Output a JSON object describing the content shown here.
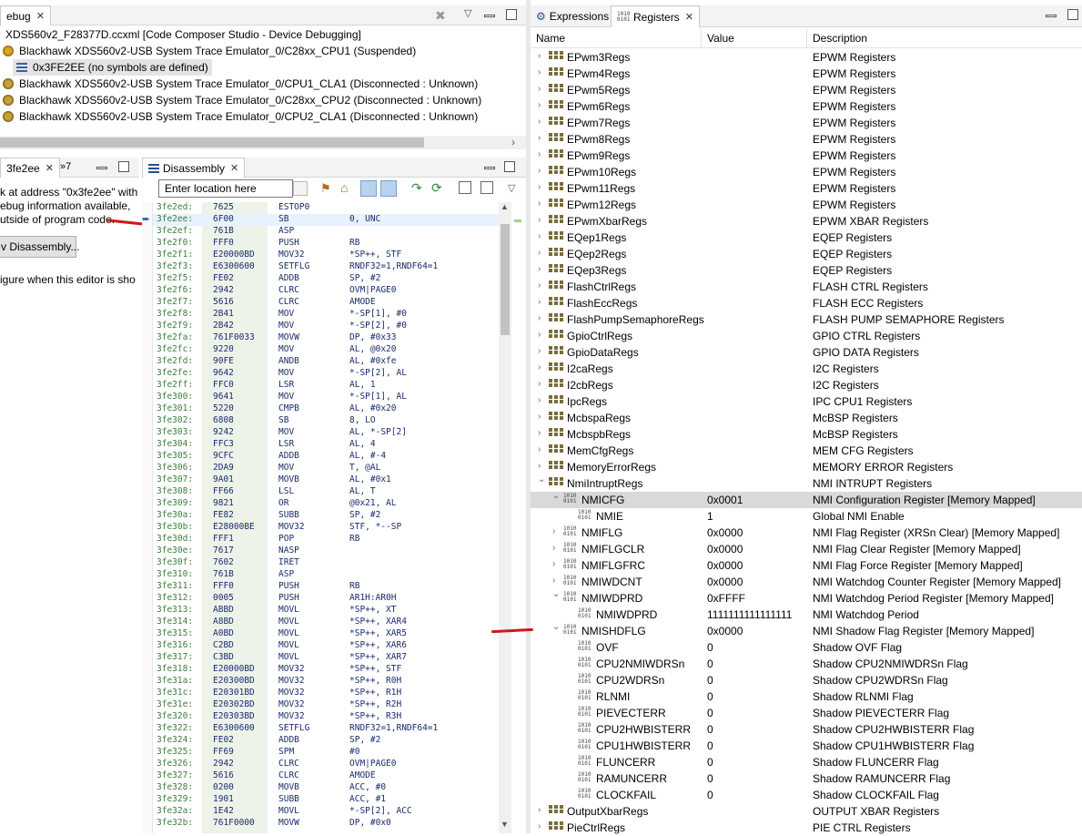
{
  "debug": {
    "tab_label": "ebug",
    "root": "XDS560v2_F28377D.ccxml [Code Composer Studio - Device Debugging]",
    "rows": [
      {
        "label": "Blackhawk XDS560v2-USB System Trace Emulator_0/C28xx_CPU1 (Suspended)"
      },
      {
        "label": "0x3FE2EE  (no symbols are defined)"
      },
      {
        "label": "Blackhawk XDS560v2-USB System Trace Emulator_0/CPU1_CLA1 (Disconnected : Unknown)"
      },
      {
        "label": "Blackhawk XDS560v2-USB System Trace Emulator_0/C28xx_CPU2 (Disconnected : Unknown)"
      },
      {
        "label": "Blackhawk XDS560v2-USB System Trace Emulator_0/CPU2_CLA1 (Disconnected : Unknown)"
      }
    ]
  },
  "editor": {
    "tab_label": "3fe2ee",
    "tab_more": "»7",
    "lines": [
      "k at address \"0x3fe2ee\" with",
      "ebug information available,",
      "utside of program code."
    ],
    "button": "v Disassembly...",
    "footer": "igure when this editor is sho"
  },
  "disassembly": {
    "tab_label": "Disassembly",
    "location_placeholder": "Enter location here",
    "rows": [
      {
        "addr": "3fe2ed:",
        "op": "7625",
        "mn": "ESTOP0",
        "arg": ""
      },
      {
        "addr": "3fe2ee:",
        "op": "6F00",
        "mn": "SB",
        "arg": "0, UNC"
      },
      {
        "addr": "3fe2ef:",
        "op": "761B",
        "mn": "ASP",
        "arg": ""
      },
      {
        "addr": "3fe2f0:",
        "op": "FFF0",
        "mn": "PUSH",
        "arg": "RB"
      },
      {
        "addr": "3fe2f1:",
        "op": "E20000BD",
        "mn": "MOV32",
        "arg": "*SP++, STF"
      },
      {
        "addr": "3fe2f3:",
        "op": "E6300600",
        "mn": "SETFLG",
        "arg": "RNDF32=1,RNDF64=1"
      },
      {
        "addr": "3fe2f5:",
        "op": "FE02",
        "mn": "ADDB",
        "arg": "SP, #2"
      },
      {
        "addr": "3fe2f6:",
        "op": "2942",
        "mn": "CLRC",
        "arg": "OVM|PAGE0"
      },
      {
        "addr": "3fe2f7:",
        "op": "5616",
        "mn": "CLRC",
        "arg": "AMODE"
      },
      {
        "addr": "3fe2f8:",
        "op": "2B41",
        "mn": "MOV",
        "arg": "*-SP[1], #0"
      },
      {
        "addr": "3fe2f9:",
        "op": "2B42",
        "mn": "MOV",
        "arg": "*-SP[2], #0"
      },
      {
        "addr": "3fe2fa:",
        "op": "761F0033",
        "mn": "MOVW",
        "arg": "DP, #0x33"
      },
      {
        "addr": "3fe2fc:",
        "op": "9220",
        "mn": "MOV",
        "arg": "AL, @0x20"
      },
      {
        "addr": "3fe2fd:",
        "op": "90FE",
        "mn": "ANDB",
        "arg": "AL, #0xfe"
      },
      {
        "addr": "3fe2fe:",
        "op": "9642",
        "mn": "MOV",
        "arg": "*-SP[2], AL"
      },
      {
        "addr": "3fe2ff:",
        "op": "FFC0",
        "mn": "LSR",
        "arg": "AL, 1"
      },
      {
        "addr": "3fe300:",
        "op": "9641",
        "mn": "MOV",
        "arg": "*-SP[1], AL"
      },
      {
        "addr": "3fe301:",
        "op": "5220",
        "mn": "CMPB",
        "arg": "AL, #0x20"
      },
      {
        "addr": "3fe302:",
        "op": "6808",
        "mn": "SB",
        "arg": "8, LO"
      },
      {
        "addr": "3fe303:",
        "op": "9242",
        "mn": "MOV",
        "arg": "AL, *-SP[2]"
      },
      {
        "addr": "3fe304:",
        "op": "FFC3",
        "mn": "LSR",
        "arg": "AL, 4"
      },
      {
        "addr": "3fe305:",
        "op": "9CFC",
        "mn": "ADDB",
        "arg": "AL, #-4"
      },
      {
        "addr": "3fe306:",
        "op": "2DA9",
        "mn": "MOV",
        "arg": "T, @AL"
      },
      {
        "addr": "3fe307:",
        "op": "9A01",
        "mn": "MOVB",
        "arg": "AL, #0x1"
      },
      {
        "addr": "3fe308:",
        "op": "FF66",
        "mn": "LSL",
        "arg": "AL, T"
      },
      {
        "addr": "3fe309:",
        "op": "9821",
        "mn": "OR",
        "arg": "@0x21, AL"
      },
      {
        "addr": "3fe30a:",
        "op": "FE82",
        "mn": "SUBB",
        "arg": "SP, #2"
      },
      {
        "addr": "3fe30b:",
        "op": "E28000BE",
        "mn": "MOV32",
        "arg": "STF, *--SP"
      },
      {
        "addr": "3fe30d:",
        "op": "FFF1",
        "mn": "POP",
        "arg": "RB"
      },
      {
        "addr": "3fe30e:",
        "op": "7617",
        "mn": "NASP",
        "arg": ""
      },
      {
        "addr": "3fe30f:",
        "op": "7602",
        "mn": "IRET",
        "arg": ""
      },
      {
        "addr": "3fe310:",
        "op": "761B",
        "mn": "ASP",
        "arg": ""
      },
      {
        "addr": "3fe311:",
        "op": "FFF0",
        "mn": "PUSH",
        "arg": "RB"
      },
      {
        "addr": "3fe312:",
        "op": "0005",
        "mn": "PUSH",
        "arg": "AR1H:AR0H"
      },
      {
        "addr": "3fe313:",
        "op": "ABBD",
        "mn": "MOVL",
        "arg": "*SP++, XT"
      },
      {
        "addr": "3fe314:",
        "op": "A8BD",
        "mn": "MOVL",
        "arg": "*SP++, XAR4"
      },
      {
        "addr": "3fe315:",
        "op": "A0BD",
        "mn": "MOVL",
        "arg": "*SP++, XAR5"
      },
      {
        "addr": "3fe316:",
        "op": "C2BD",
        "mn": "MOVL",
        "arg": "*SP++, XAR6"
      },
      {
        "addr": "3fe317:",
        "op": "C3BD",
        "mn": "MOVL",
        "arg": "*SP++, XAR7"
      },
      {
        "addr": "3fe318:",
        "op": "E20000BD",
        "mn": "MOV32",
        "arg": "*SP++, STF"
      },
      {
        "addr": "3fe31a:",
        "op": "E20300BD",
        "mn": "MOV32",
        "arg": "*SP++, R0H"
      },
      {
        "addr": "3fe31c:",
        "op": "E20301BD",
        "mn": "MOV32",
        "arg": "*SP++, R1H"
      },
      {
        "addr": "3fe31e:",
        "op": "E20302BD",
        "mn": "MOV32",
        "arg": "*SP++, R2H"
      },
      {
        "addr": "3fe320:",
        "op": "E20303BD",
        "mn": "MOV32",
        "arg": "*SP++, R3H"
      },
      {
        "addr": "3fe322:",
        "op": "E6300600",
        "mn": "SETFLG",
        "arg": "RNDF32=1,RNDF64=1"
      },
      {
        "addr": "3fe324:",
        "op": "FE02",
        "mn": "ADDB",
        "arg": "SP, #2"
      },
      {
        "addr": "3fe325:",
        "op": "FF69",
        "mn": "SPM",
        "arg": "#0"
      },
      {
        "addr": "3fe326:",
        "op": "2942",
        "mn": "CLRC",
        "arg": "OVM|PAGE0"
      },
      {
        "addr": "3fe327:",
        "op": "5616",
        "mn": "CLRC",
        "arg": "AMODE"
      },
      {
        "addr": "3fe328:",
        "op": "0200",
        "mn": "MOVB",
        "arg": "ACC, #0"
      },
      {
        "addr": "3fe329:",
        "op": "1901",
        "mn": "SUBB",
        "arg": "ACC, #1"
      },
      {
        "addr": "3fe32a:",
        "op": "1E42",
        "mn": "MOVL",
        "arg": "*-SP[2], ACC"
      },
      {
        "addr": "3fe32b:",
        "op": "761F0000",
        "mn": "MOVW",
        "arg": "DP, #0x0"
      }
    ]
  },
  "registers": {
    "tab_expressions": "Expressions",
    "tab_registers": "Registers",
    "col_name": "Name",
    "col_value": "Value",
    "col_desc": "Description",
    "rows": [
      {
        "level": 0,
        "exp": "closed",
        "icon": "grid",
        "name": "EPwm3Regs",
        "value": "",
        "desc": "EPWM Registers"
      },
      {
        "level": 0,
        "exp": "closed",
        "icon": "grid",
        "name": "EPwm4Regs",
        "value": "",
        "desc": "EPWM Registers"
      },
      {
        "level": 0,
        "exp": "closed",
        "icon": "grid",
        "name": "EPwm5Regs",
        "value": "",
        "desc": "EPWM Registers"
      },
      {
        "level": 0,
        "exp": "closed",
        "icon": "grid",
        "name": "EPwm6Regs",
        "value": "",
        "desc": "EPWM Registers"
      },
      {
        "level": 0,
        "exp": "closed",
        "icon": "grid",
        "name": "EPwm7Regs",
        "value": "",
        "desc": "EPWM Registers"
      },
      {
        "level": 0,
        "exp": "closed",
        "icon": "grid",
        "name": "EPwm8Regs",
        "value": "",
        "desc": "EPWM Registers"
      },
      {
        "level": 0,
        "exp": "closed",
        "icon": "grid",
        "name": "EPwm9Regs",
        "value": "",
        "desc": "EPWM Registers"
      },
      {
        "level": 0,
        "exp": "closed",
        "icon": "grid",
        "name": "EPwm10Regs",
        "value": "",
        "desc": "EPWM Registers"
      },
      {
        "level": 0,
        "exp": "closed",
        "icon": "grid",
        "name": "EPwm11Regs",
        "value": "",
        "desc": "EPWM Registers"
      },
      {
        "level": 0,
        "exp": "closed",
        "icon": "grid",
        "name": "EPwm12Regs",
        "value": "",
        "desc": "EPWM Registers"
      },
      {
        "level": 0,
        "exp": "closed",
        "icon": "grid",
        "name": "EPwmXbarRegs",
        "value": "",
        "desc": "EPWM XBAR Registers"
      },
      {
        "level": 0,
        "exp": "closed",
        "icon": "grid",
        "name": "EQep1Regs",
        "value": "",
        "desc": "EQEP Registers"
      },
      {
        "level": 0,
        "exp": "closed",
        "icon": "grid",
        "name": "EQep2Regs",
        "value": "",
        "desc": "EQEP Registers"
      },
      {
        "level": 0,
        "exp": "closed",
        "icon": "grid",
        "name": "EQep3Regs",
        "value": "",
        "desc": "EQEP Registers"
      },
      {
        "level": 0,
        "exp": "closed",
        "icon": "grid",
        "name": "FlashCtrlRegs",
        "value": "",
        "desc": "FLASH CTRL Registers"
      },
      {
        "level": 0,
        "exp": "closed",
        "icon": "grid",
        "name": "FlashEccRegs",
        "value": "",
        "desc": "FLASH ECC Registers"
      },
      {
        "level": 0,
        "exp": "closed",
        "icon": "grid",
        "name": "FlashPumpSemaphoreRegs",
        "value": "",
        "desc": "FLASH PUMP SEMAPHORE Registers"
      },
      {
        "level": 0,
        "exp": "closed",
        "icon": "grid",
        "name": "GpioCtrlRegs",
        "value": "",
        "desc": "GPIO CTRL Registers"
      },
      {
        "level": 0,
        "exp": "closed",
        "icon": "grid",
        "name": "GpioDataRegs",
        "value": "",
        "desc": "GPIO DATA Registers"
      },
      {
        "level": 0,
        "exp": "closed",
        "icon": "grid",
        "name": "I2caRegs",
        "value": "",
        "desc": "I2C Registers"
      },
      {
        "level": 0,
        "exp": "closed",
        "icon": "grid",
        "name": "I2cbRegs",
        "value": "",
        "desc": "I2C Registers"
      },
      {
        "level": 0,
        "exp": "closed",
        "icon": "grid",
        "name": "IpcRegs",
        "value": "",
        "desc": "IPC CPU1 Registers"
      },
      {
        "level": 0,
        "exp": "closed",
        "icon": "grid",
        "name": "McbspaRegs",
        "value": "",
        "desc": "McBSP Registers"
      },
      {
        "level": 0,
        "exp": "closed",
        "icon": "grid",
        "name": "McbspbRegs",
        "value": "",
        "desc": "McBSP Registers"
      },
      {
        "level": 0,
        "exp": "closed",
        "icon": "grid",
        "name": "MemCfgRegs",
        "value": "",
        "desc": "MEM CFG Registers"
      },
      {
        "level": 0,
        "exp": "closed",
        "icon": "grid",
        "name": "MemoryErrorRegs",
        "value": "",
        "desc": "MEMORY ERROR Registers"
      },
      {
        "level": 0,
        "exp": "open",
        "icon": "grid",
        "name": "NmiIntruptRegs",
        "value": "",
        "desc": "NMI INTRUPT Registers"
      },
      {
        "level": 1,
        "exp": "open",
        "icon": "bits",
        "name": "NMICFG",
        "value": "0x0001",
        "desc": "NMI Configuration Register [Memory Mapped]",
        "sel": true
      },
      {
        "level": 2,
        "exp": "none",
        "icon": "bits",
        "name": "NMIE",
        "value": "1",
        "desc": "Global NMI Enable"
      },
      {
        "level": 1,
        "exp": "closed",
        "icon": "bits",
        "name": "NMIFLG",
        "value": "0x0000",
        "desc": "NMI Flag Register (XRSn Clear) [Memory Mapped]"
      },
      {
        "level": 1,
        "exp": "closed",
        "icon": "bits",
        "name": "NMIFLGCLR",
        "value": "0x0000",
        "desc": "NMI Flag Clear Register [Memory Mapped]"
      },
      {
        "level": 1,
        "exp": "closed",
        "icon": "bits",
        "name": "NMIFLGFRC",
        "value": "0x0000",
        "desc": "NMI Flag Force Register [Memory Mapped]"
      },
      {
        "level": 1,
        "exp": "closed",
        "icon": "bits",
        "name": "NMIWDCNT",
        "value": "0x0000",
        "desc": "NMI Watchdog Counter Register [Memory Mapped]"
      },
      {
        "level": 1,
        "exp": "open",
        "icon": "bits",
        "name": "NMIWDPRD",
        "value": "0xFFFF",
        "desc": "NMI Watchdog Period Register [Memory Mapped]"
      },
      {
        "level": 2,
        "exp": "none",
        "icon": "bits",
        "name": "NMIWDPRD",
        "value": "1111111111111111",
        "desc": "NMI Watchdog Period"
      },
      {
        "level": 1,
        "exp": "open",
        "icon": "bits",
        "name": "NMISHDFLG",
        "value": "0x0000",
        "desc": "NMI Shadow Flag Register [Memory Mapped]"
      },
      {
        "level": 2,
        "exp": "none",
        "icon": "bits",
        "name": "OVF",
        "value": "0",
        "desc": "Shadow OVF Flag"
      },
      {
        "level": 2,
        "exp": "none",
        "icon": "bits",
        "name": "CPU2NMIWDRSn",
        "value": "0",
        "desc": "Shadow CPU2NMIWDRSn Flag"
      },
      {
        "level": 2,
        "exp": "none",
        "icon": "bits",
        "name": "CPU2WDRSn",
        "value": "0",
        "desc": "Shadow CPU2WDRSn Flag"
      },
      {
        "level": 2,
        "exp": "none",
        "icon": "bits",
        "name": "RLNMI",
        "value": "0",
        "desc": "Shadow RLNMI Flag"
      },
      {
        "level": 2,
        "exp": "none",
        "icon": "bits",
        "name": "PIEVECTERR",
        "value": "0",
        "desc": "Shadow PIEVECTERR Flag"
      },
      {
        "level": 2,
        "exp": "none",
        "icon": "bits",
        "name": "CPU2HWBISTERR",
        "value": "0",
        "desc": "Shadow CPU2HWBISTERR Flag"
      },
      {
        "level": 2,
        "exp": "none",
        "icon": "bits",
        "name": "CPU1HWBISTERR",
        "value": "0",
        "desc": "Shadow CPU1HWBISTERR Flag"
      },
      {
        "level": 2,
        "exp": "none",
        "icon": "bits",
        "name": "FLUNCERR",
        "value": "0",
        "desc": "Shadow FLUNCERR Flag"
      },
      {
        "level": 2,
        "exp": "none",
        "icon": "bits",
        "name": "RAMUNCERR",
        "value": "0",
        "desc": "Shadow RAMUNCERR Flag"
      },
      {
        "level": 2,
        "exp": "none",
        "icon": "bits",
        "name": "CLOCKFAIL",
        "value": "0",
        "desc": "Shadow CLOCKFAIL Flag"
      },
      {
        "level": 0,
        "exp": "closed",
        "icon": "grid",
        "name": "OutputXbarRegs",
        "value": "",
        "desc": "OUTPUT XBAR Registers"
      },
      {
        "level": 0,
        "exp": "closed",
        "icon": "grid",
        "name": "PieCtrlRegs",
        "value": "",
        "desc": "PIE CTRL Registers"
      }
    ]
  }
}
